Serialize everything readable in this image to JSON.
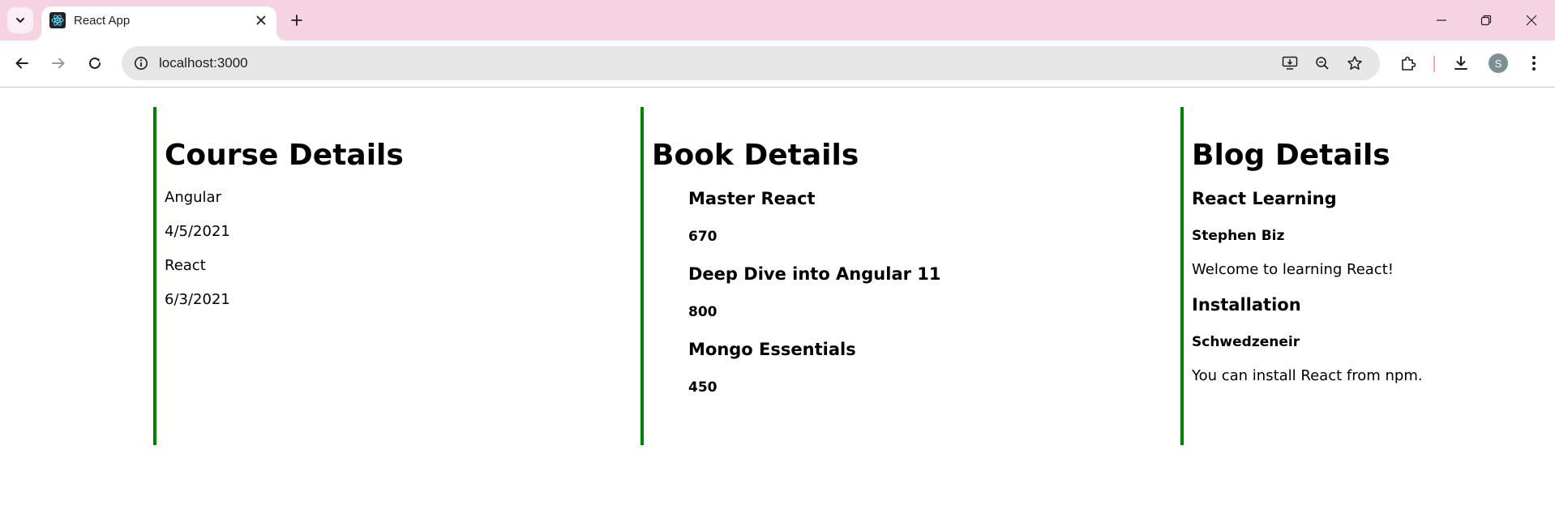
{
  "browser": {
    "tab_title": "React App",
    "url": "localhost:3000",
    "profile_initial": "S"
  },
  "courses": {
    "heading": "Course Details",
    "items": [
      {
        "name": "Angular",
        "date": "4/5/2021"
      },
      {
        "name": "React",
        "date": "6/3/2021"
      }
    ]
  },
  "books": {
    "heading": "Book Details",
    "items": [
      {
        "title": "Master React",
        "price": "670"
      },
      {
        "title": "Deep Dive into Angular 11",
        "price": "800"
      },
      {
        "title": "Mongo Essentials",
        "price": "450"
      }
    ]
  },
  "blogs": {
    "heading": "Blog Details",
    "items": [
      {
        "title": "React Learning",
        "author": "Stephen Biz",
        "text": "Welcome to learning React!"
      },
      {
        "title": "Installation",
        "author": "Schwedzeneir",
        "text": "You can install React from npm."
      }
    ]
  },
  "colors": {
    "accent_border": "#008000",
    "tabbar_bg": "#f5d3e3"
  }
}
